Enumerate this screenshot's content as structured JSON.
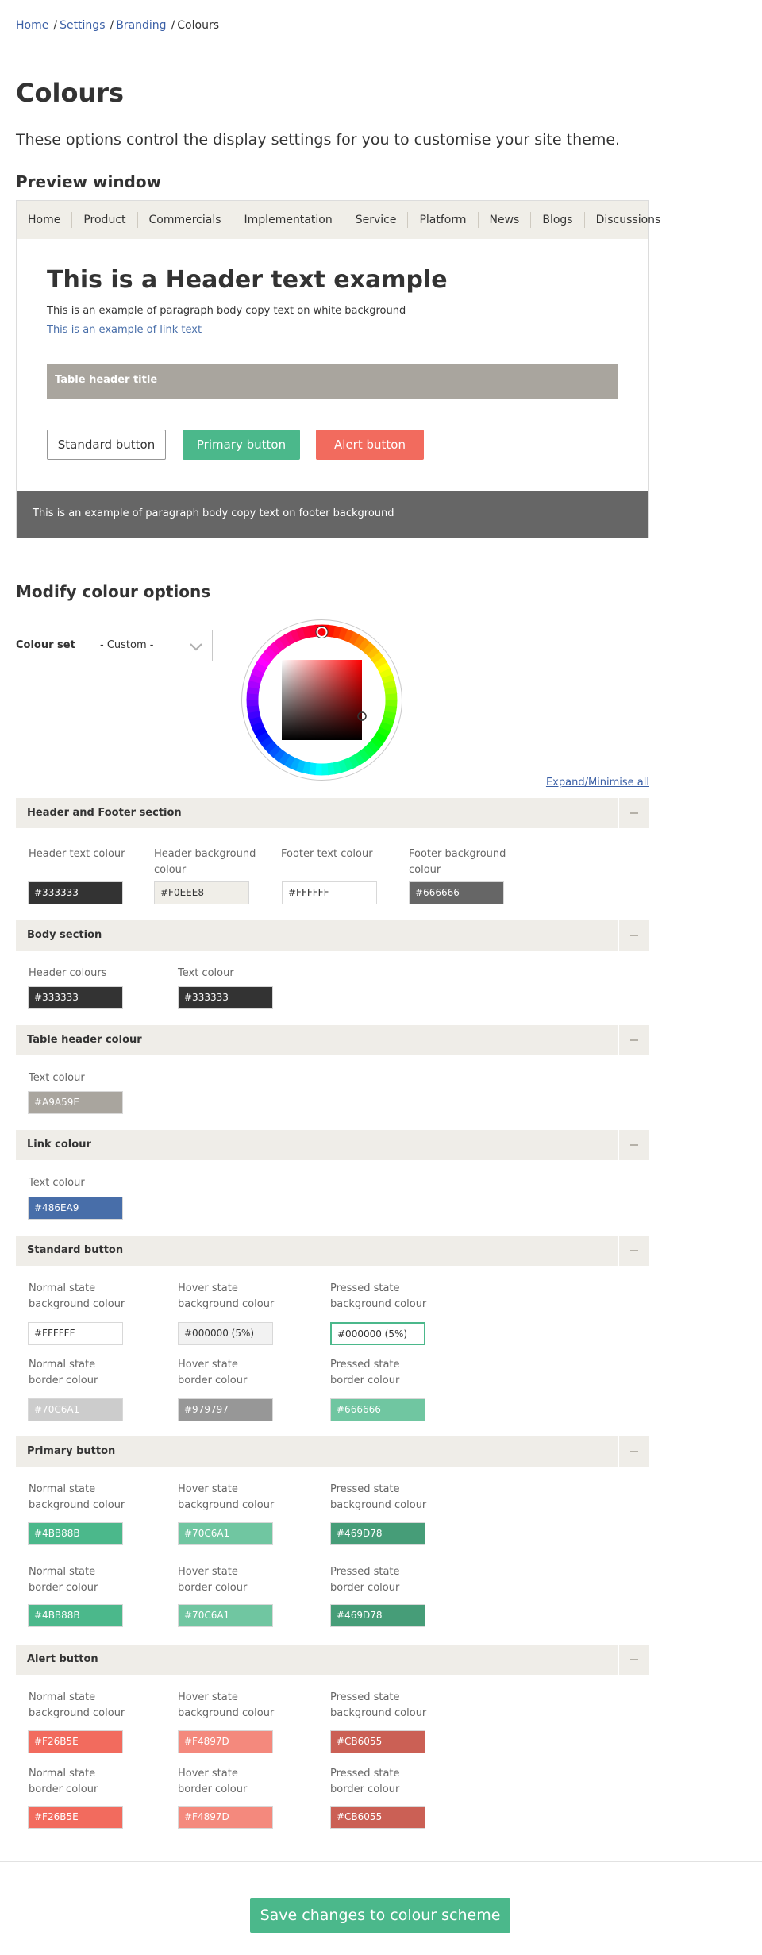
{
  "breadcrumb": {
    "items": [
      "Home",
      "Settings",
      "Branding"
    ],
    "separator": "/",
    "current": "Colours"
  },
  "page": {
    "title": "Colours",
    "intro": "These options control the display settings for you to customise your site theme."
  },
  "preview": {
    "heading": "Preview window",
    "nav": [
      "Home",
      "Product",
      "Commercials",
      "Implementation",
      "Service",
      "Platform",
      "News",
      "Blogs",
      "Discussions"
    ],
    "header_text": "This is a Header text example",
    "paragraph": "This is an example of paragraph body copy text on white background",
    "link_text": "This is an example of link text",
    "table_header": "Table header title",
    "standard_button": "Standard button",
    "primary_button": "Primary button",
    "alert_button": "Alert button",
    "footer_text": "This is an example of paragraph body copy text on footer background"
  },
  "modify": {
    "heading": "Modify colour options",
    "colour_set_label": "Colour set",
    "colour_set_value": "- Custom -",
    "expand_link": "Expand/Minimise all"
  },
  "sections": {
    "header_footer": {
      "title": "Header and Footer section",
      "fields": [
        {
          "label1": "Header text colour",
          "label2": "",
          "value": "#333333",
          "color": "#333333"
        },
        {
          "label1": "Header background",
          "label2": "colour",
          "value": "#F0EEE8",
          "color": "#F0EEE8"
        },
        {
          "label1": "Footer text colour",
          "label2": "",
          "value": "#FFFFFF",
          "color": "#FFFFFF"
        },
        {
          "label1": "Footer background",
          "label2": "colour",
          "value": "#666666",
          "color": "#666666"
        }
      ]
    },
    "body": {
      "title": "Body section",
      "fields": [
        {
          "label1": "Header colours",
          "value": "#333333",
          "color": "#333333"
        },
        {
          "label1": "Text colour",
          "value": "#333333",
          "color": "#333333"
        }
      ]
    },
    "table_header": {
      "title": "Table header colour",
      "fields": [
        {
          "label1": "Text colour",
          "value": "#A9A59E",
          "color": "#A9A59E"
        }
      ]
    },
    "link": {
      "title": "Link colour",
      "fields": [
        {
          "label1": "Text colour",
          "value": "#486EA9",
          "color": "#486EA9"
        }
      ]
    },
    "standard_button": {
      "title": "Standard button",
      "fields": [
        {
          "label1": "Normal state",
          "label2": "background colour",
          "value": "#FFFFFF",
          "color": "#FFFFFF"
        },
        {
          "label1": "Hover state",
          "label2": "background colour",
          "value": "#000000 (5%)",
          "color": "#F2F2F2"
        },
        {
          "label1": "Pressed state",
          "label2": "background colour",
          "value": "#000000 (5%)",
          "color": "#FFFFFF"
        },
        {
          "label1": "Normal state",
          "label2": "border colour",
          "value": "#70C6A1",
          "color": "#CCCCCC"
        },
        {
          "label1": "Hover state",
          "label2": "border colour",
          "value": "#979797",
          "color": "#979797"
        },
        {
          "label1": "Pressed state",
          "label2": "border colour",
          "value": "#666666",
          "color": "#70C6A1"
        }
      ]
    },
    "primary_button": {
      "title": "Primary button",
      "fields": [
        {
          "label1": "Normal state",
          "label2": "background colour",
          "value": "#4BB88B",
          "color": "#4BB88B"
        },
        {
          "label1": "Hover state",
          "label2": "background colour",
          "value": "#70C6A1",
          "color": "#70C6A1"
        },
        {
          "label1": "Pressed state",
          "label2": "background colour",
          "value": "#469D78",
          "color": "#469D78"
        },
        {
          "label1": "Normal state",
          "label2": "border colour",
          "value": "#4BB88B",
          "color": "#4BB88B"
        },
        {
          "label1": "Hover state",
          "label2": "border colour",
          "value": "#70C6A1",
          "color": "#70C6A1"
        },
        {
          "label1": "Pressed state",
          "label2": "border colour",
          "value": "#469D78",
          "color": "#469D78"
        }
      ]
    },
    "alert_button": {
      "title": "Alert button",
      "fields": [
        {
          "label1": "Normal state",
          "label2": "background colour",
          "value": "#F26B5E",
          "color": "#F26B5E"
        },
        {
          "label1": "Hover state",
          "label2": "background colour",
          "value": "#F4897D",
          "color": "#F4897D"
        },
        {
          "label1": "Pressed state",
          "label2": "background colour",
          "value": "#CB6055",
          "color": "#CB6055"
        },
        {
          "label1": "Normal state",
          "label2": "border colour",
          "value": "#F26B5E",
          "color": "#F26B5E"
        },
        {
          "label1": "Hover state",
          "label2": "border colour",
          "value": "#F4897D",
          "color": "#F4897D"
        },
        {
          "label1": "Pressed state",
          "label2": "border colour",
          "value": "#CB6055",
          "color": "#CB6055"
        }
      ]
    }
  },
  "save_button": "Save changes to colour scheme",
  "colors": {
    "link": "#3a5fa6",
    "primary": "#4bb88b",
    "alert": "#f26b5e",
    "section_header_bg": "#efede8",
    "footer": "#666666"
  }
}
